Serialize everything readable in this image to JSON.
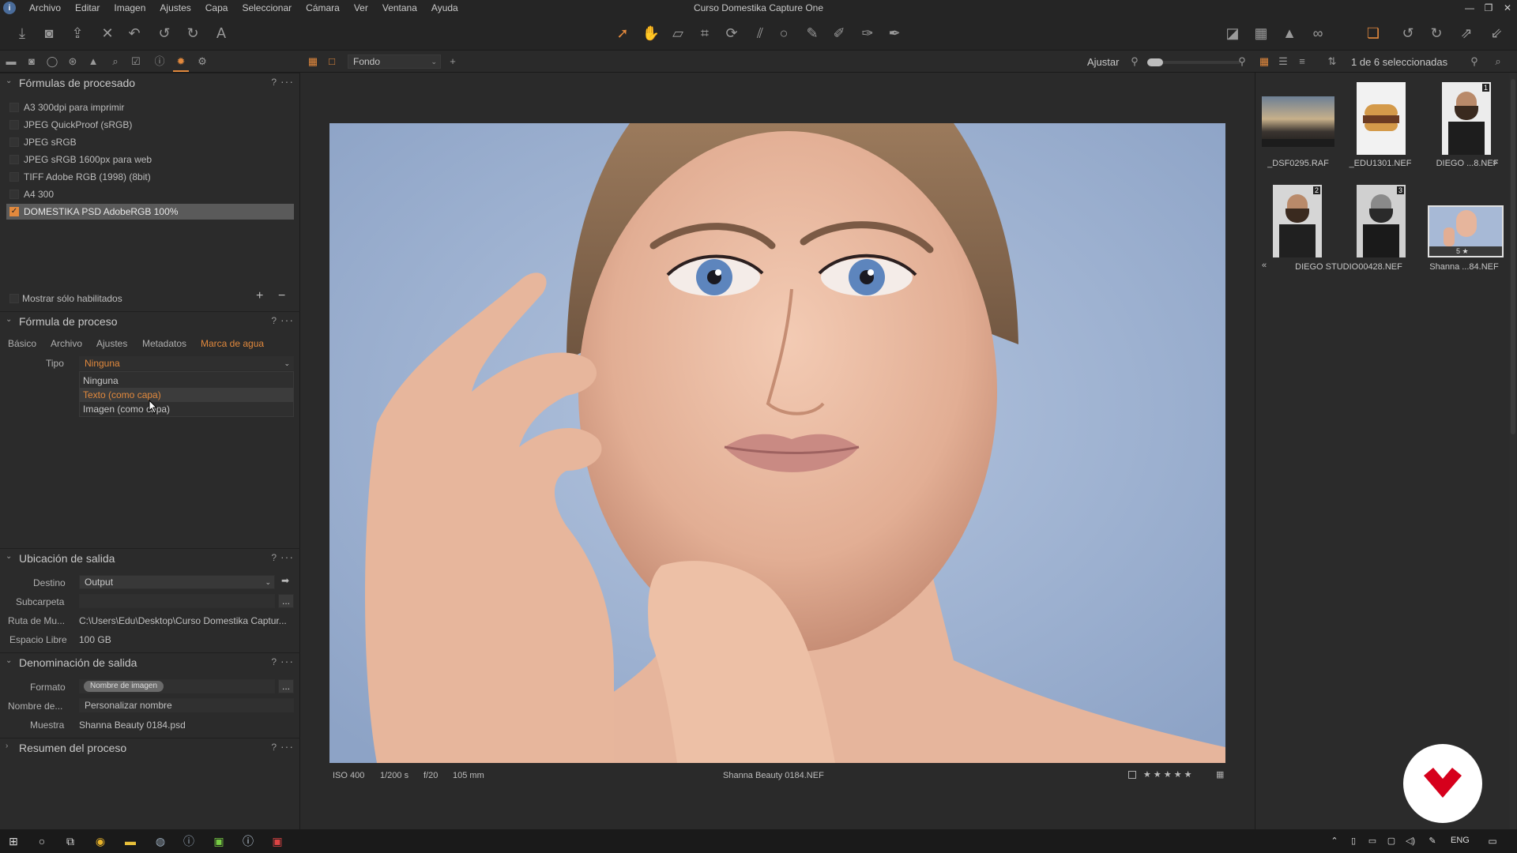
{
  "window": {
    "title": "Curso Domestika Capture One"
  },
  "menubar": {
    "items": [
      "Archivo",
      "Editar",
      "Imagen",
      "Ajustes",
      "Capa",
      "Seleccionar",
      "Cámara",
      "Ver",
      "Ventana",
      "Ayuda"
    ]
  },
  "toolbar": {
    "left_icons": [
      "import-icon",
      "camera-icon",
      "export-icon",
      "delete-icon",
      "reset-icon",
      "undo-icon",
      "redo-icon",
      "text-icon"
    ],
    "center_icons": [
      "cursor-icon",
      "pan-icon",
      "perspective-icon",
      "crop-icon",
      "rotate-icon",
      "keystone-icon",
      "spot-icon",
      "brush-icon",
      "erase-icon",
      "linear-gradient-icon",
      "radial-gradient-icon"
    ],
    "right_icons": [
      "compare-icon",
      "grid-icon",
      "exposure-warning-icon",
      "proof-icon",
      "layers-icon",
      "rotate-left-icon",
      "rotate-right-icon",
      "expand-icon",
      "collapse-icon"
    ]
  },
  "viewer_bar": {
    "layer_select": "Fondo",
    "fit_label": "Ajustar",
    "selection_count": "1 de 6 seleccionadas"
  },
  "recipes_section": {
    "title": "Fórmulas de procesado",
    "help": "?",
    "more": "···",
    "items": [
      {
        "label": "A3 300dpi para imprimir",
        "checked": false
      },
      {
        "label": "JPEG QuickProof (sRGB)",
        "checked": false
      },
      {
        "label": "JPEG sRGB",
        "checked": false
      },
      {
        "label": "JPEG sRGB 1600px para web",
        "checked": false
      },
      {
        "label": "TIFF Adobe RGB (1998) (8bit)",
        "checked": false
      },
      {
        "label": "A4 300",
        "checked": false
      },
      {
        "label": "DOMESTIKA PSD AdobeRGB 100%",
        "checked": true
      }
    ],
    "show_enabled_label": "Mostrar sólo habilitados",
    "add": "+",
    "remove": "−"
  },
  "process_recipe": {
    "title": "Fórmula de proceso",
    "help": "?",
    "more": "···",
    "tabs": [
      "Básico",
      "Archivo",
      "Ajustes",
      "Metadatos",
      "Marca de agua"
    ],
    "active_tab": "Marca de agua",
    "type_label": "Tipo",
    "type_value": "Ninguna",
    "options": [
      "Ninguna",
      "Texto (como capa)",
      "Imagen (como capa)"
    ]
  },
  "output_location": {
    "title": "Ubicación de salida",
    "help": "?",
    "more": "···",
    "dest_label": "Destino",
    "dest_value": "Output",
    "subfolder_label": "Subcarpeta",
    "subfolder_btn": "...",
    "path_label": "Ruta de Mu...",
    "path_value": "C:\\Users\\Edu\\Desktop\\Curso Domestika Captur...",
    "free_label": "Espacio Libre",
    "free_value": "100 GB"
  },
  "output_naming": {
    "title": "Denominación de salida",
    "help": "?",
    "more": "···",
    "format_label": "Formato",
    "format_token": "Nombre de imagen",
    "format_btn": "...",
    "name_label": "Nombre de...",
    "name_value": "Personalizar nombre",
    "sample_label": "Muestra",
    "sample_value": "Shanna Beauty 0184.psd"
  },
  "process_summary": {
    "title": "Resumen del proceso",
    "help": "?",
    "more": "···"
  },
  "viewer_status": {
    "iso": "ISO 400",
    "shutter": "1/200 s",
    "aperture": "f/20",
    "focal": "105 mm",
    "filename": "Shanna Beauty 0184.NEF",
    "stars": "★ ★ ★ ★ ★"
  },
  "browser": {
    "thumbnails": [
      {
        "name": "_DSF0295.RAF",
        "badge": ""
      },
      {
        "name": "_EDU1301.NEF",
        "badge": ""
      },
      {
        "name": "DIEGO ...8.NEF",
        "badge": "1"
      },
      {
        "name": "DIEGO STUDIO00428.NEF",
        "badge": "2"
      },
      {
        "name": "",
        "badge": "3"
      },
      {
        "name": "Shanna ...84.NEF",
        "badge": "5"
      }
    ]
  },
  "taskbar": {
    "lang": "ENG"
  },
  "colors": {
    "accent": "#e2893d",
    "panel": "#2b2b2b",
    "bar": "#252525",
    "brand": "#d6001c"
  }
}
